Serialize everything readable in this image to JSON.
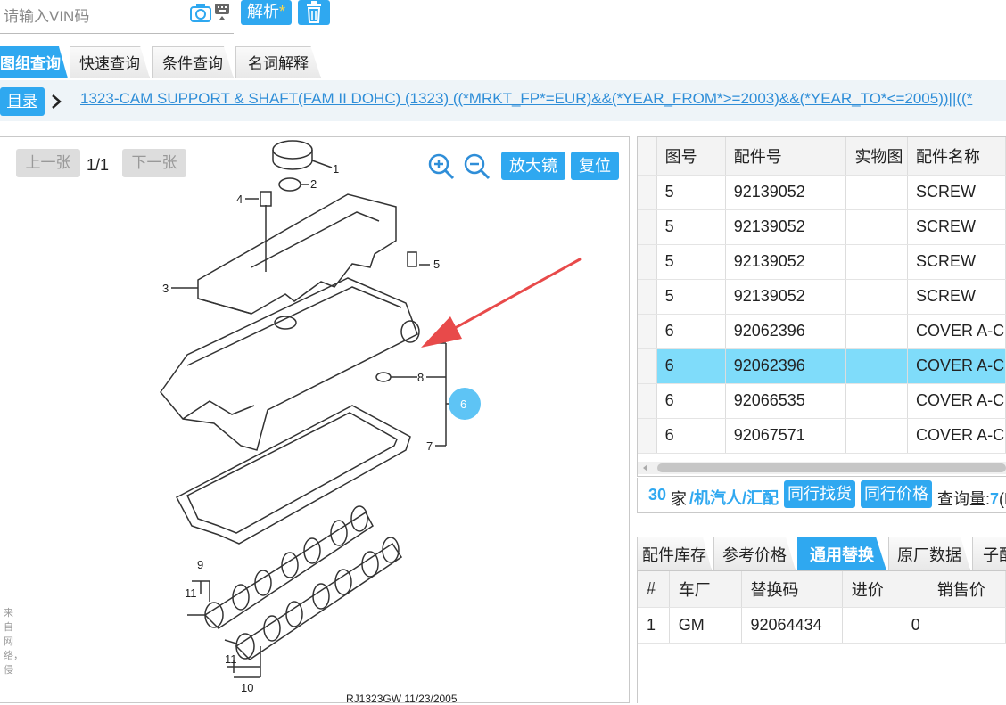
{
  "search": {
    "placeholder": "请输入VIN码",
    "parse_label": "解析",
    "parse_star": "*"
  },
  "tabs": [
    {
      "label": "图组查询"
    },
    {
      "label": "快速查询"
    },
    {
      "label": "条件查询"
    },
    {
      "label": "名词解释"
    }
  ],
  "breadcrumb": {
    "catalog_label": "目录",
    "path": "1323-CAM SUPPORT & SHAFT(FAM II DOHC)  (1323)   ((*MRKT_FP*=EUR)&&(*YEAR_FROM*>=2003)&&(*YEAR_TO*<=2005))||((*"
  },
  "viewer": {
    "prev_label": "上一张",
    "page": "1/1",
    "next_label": "下一张",
    "magnifier_label": "放大镜",
    "reset_label": "复位",
    "caption": "RJ1323GW  11/23/2005",
    "watermark": "来自网络，侵"
  },
  "diagram": {
    "callouts": [
      "1",
      "2",
      "3",
      "4",
      "5",
      "8",
      "7",
      "6",
      "9",
      "11",
      "11",
      "10"
    ],
    "highlight_callout": "6"
  },
  "parts": {
    "headers": [
      "图号",
      "配件号",
      "实物图",
      "配件名称"
    ],
    "rows": [
      {
        "no": "5",
        "part": "92139052",
        "img": "",
        "name": "SCREW"
      },
      {
        "no": "5",
        "part": "92139052",
        "img": "",
        "name": "SCREW"
      },
      {
        "no": "5",
        "part": "92139052",
        "img": "",
        "name": "SCREW"
      },
      {
        "no": "5",
        "part": "92139052",
        "img": "",
        "name": "SCREW"
      },
      {
        "no": "6",
        "part": "92062396",
        "img": "",
        "name": "COVER A-C"
      },
      {
        "no": "6",
        "part": "92062396",
        "img": "",
        "name": "COVER A-C"
      },
      {
        "no": "6",
        "part": "92066535",
        "img": "",
        "name": "COVER A-C"
      },
      {
        "no": "6",
        "part": "92067571",
        "img": "",
        "name": "COVER A-C"
      }
    ],
    "selected_index": 5
  },
  "supplier_bar": {
    "count": "30",
    "count_unit": "家",
    "source": "/机汽人/汇配",
    "find_label": "同行找货",
    "price_label": "同行价格",
    "query_label": "查询量:",
    "query_value": "7",
    "query_tail": "(E"
  },
  "bottom_tabs": [
    {
      "label": "配件库存"
    },
    {
      "label": "参考价格"
    },
    {
      "label": "通用替换"
    },
    {
      "label": "原厂数据"
    },
    {
      "label": "子配"
    }
  ],
  "replacement": {
    "headers": [
      "#",
      "车厂",
      "替换码",
      "进价",
      "销售价"
    ],
    "rows": [
      {
        "idx": "1",
        "maker": "GM",
        "code": "92064434",
        "cost": "0",
        "price": ""
      }
    ]
  },
  "colors": {
    "accent": "#2fa8f0",
    "selected_row": "#7fdcfa",
    "arrow": "#e84a4a"
  }
}
